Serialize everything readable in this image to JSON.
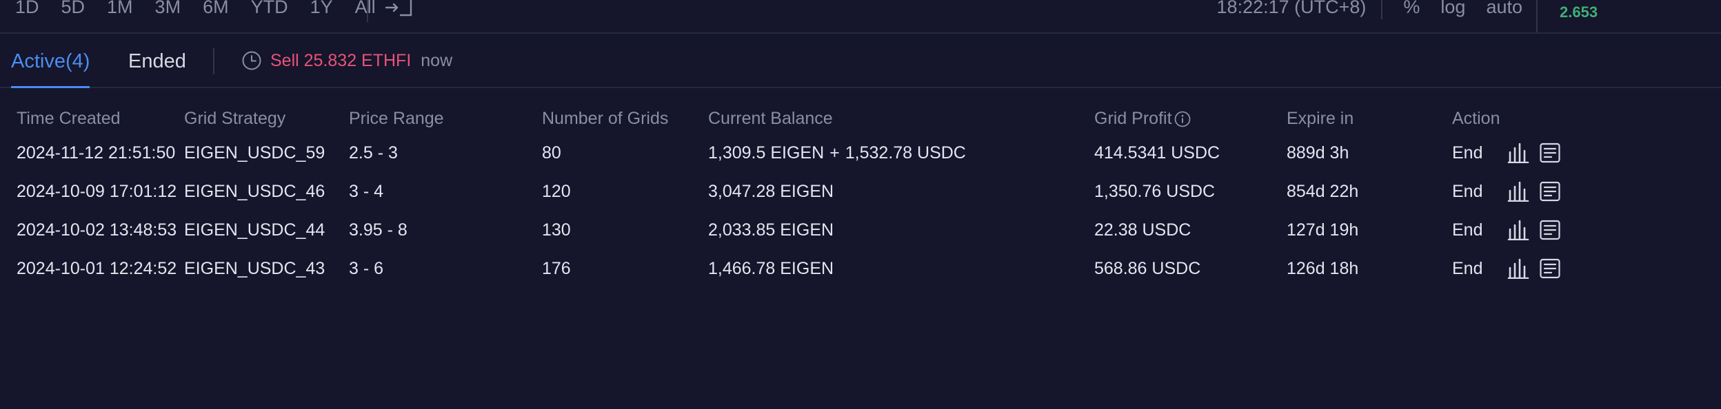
{
  "toolbar": {
    "ranges": [
      "1D",
      "5D",
      "1M",
      "3M",
      "6M",
      "YTD",
      "1Y",
      "All"
    ],
    "clock": "18:22:17 (UTC+8)",
    "options": [
      "%",
      "log",
      "auto"
    ],
    "side_value": "2.653",
    "colors": {
      "side_value": "#3fae78",
      "muted": "#8a8ea6"
    }
  },
  "tabs": {
    "active": "Active(4)",
    "ended": "Ended",
    "notification": {
      "text": "Sell 25.832 ETHFI",
      "time": "now"
    },
    "colors": {
      "active": "#4a8df0",
      "sell": "#e8537a"
    }
  },
  "table": {
    "headers": [
      "Time Created",
      "Grid Strategy",
      "Price Range",
      "Number of Grids",
      "Current Balance",
      "Grid Profit",
      "Expire in",
      "Action"
    ],
    "rows": [
      {
        "time": "2024-11-12 21:51:50",
        "strategy": "EIGEN_USDC_59",
        "range": "2.5 - 3",
        "grids": "80",
        "balance_a": "1,309.5 EIGEN",
        "plus": "+",
        "balance_b": "1,532.78 USDC",
        "profit": "414.5341 USDC",
        "expire": "889d 3h",
        "action": "End"
      },
      {
        "time": "2024-10-09 17:01:12",
        "strategy": "EIGEN_USDC_46",
        "range": "3 - 4",
        "grids": "120",
        "balance_a": "3,047.28 EIGEN",
        "plus": "",
        "balance_b": "",
        "profit": "1,350.76 USDC",
        "expire": "854d 22h",
        "action": "End"
      },
      {
        "time": "2024-10-02 13:48:53",
        "strategy": "EIGEN_USDC_44",
        "range": "3.95 - 8",
        "grids": "130",
        "balance_a": "2,033.85 EIGEN",
        "plus": "",
        "balance_b": "",
        "profit": "22.38 USDC",
        "expire": "127d 19h",
        "action": "End"
      },
      {
        "time": "2024-10-01 12:24:52",
        "strategy": "EIGEN_USDC_43",
        "range": "3 - 6",
        "grids": "176",
        "balance_a": "1,466.78 EIGEN",
        "plus": "",
        "balance_b": "",
        "profit": "568.86 USDC",
        "expire": "126d 18h",
        "action": "End"
      }
    ]
  },
  "icons": {
    "toolbar": "screenshot-icon",
    "notification": "clock-icon",
    "profit_header": "info-icon",
    "row_actions": [
      "bar-chart-icon",
      "details-icon"
    ]
  }
}
